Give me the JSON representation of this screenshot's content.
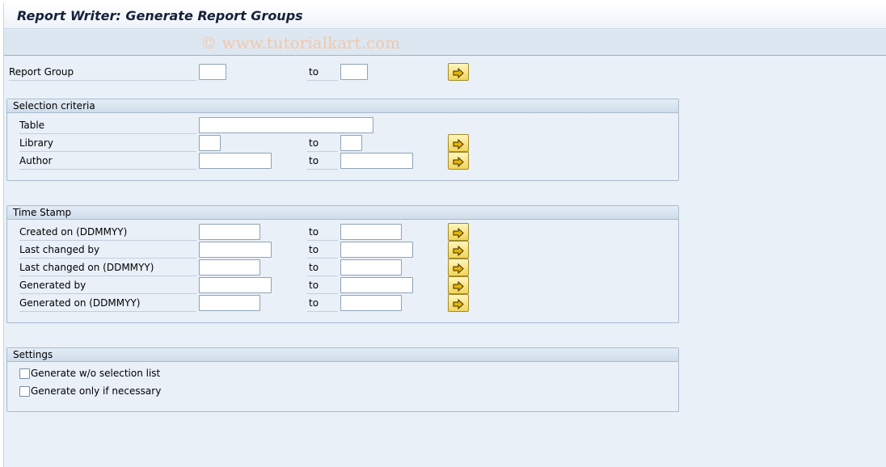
{
  "title": "Report Writer: Generate Report Groups",
  "watermark": "© www.tutorialkart.com",
  "report_group": {
    "label": "Report Group",
    "to": "to",
    "from_value": "",
    "to_value": ""
  },
  "selection_criteria": {
    "heading": "Selection criteria",
    "table": {
      "label": "Table",
      "value": ""
    },
    "library": {
      "label": "Library",
      "to": "to",
      "from_value": "",
      "to_value": ""
    },
    "author": {
      "label": "Author",
      "to": "to",
      "from_value": "",
      "to_value": ""
    }
  },
  "time_stamp": {
    "heading": "Time Stamp",
    "rows": [
      {
        "label": "Created on (DDMMYY)",
        "to": "to",
        "from_value": "",
        "to_value": ""
      },
      {
        "label": "Last changed by",
        "to": "to",
        "from_value": "",
        "to_value": ""
      },
      {
        "label": "Last changed on (DDMMYY)",
        "to": "to",
        "from_value": "",
        "to_value": ""
      },
      {
        "label": "Generated by",
        "to": "to",
        "from_value": "",
        "to_value": ""
      },
      {
        "label": "Generated on (DDMMYY)",
        "to": "to",
        "from_value": "",
        "to_value": ""
      }
    ]
  },
  "settings": {
    "heading": "Settings",
    "options": [
      {
        "label": "Generate w/o selection list",
        "checked": false
      },
      {
        "label": "Generate only if necessary",
        "checked": false
      }
    ]
  },
  "colors": {
    "background": "#e9f0f8",
    "button": "#f2d55a",
    "arrow": "#e8b400",
    "watermark": "#f3c7a7"
  },
  "icons": {
    "multiple_selection": "arrow-right-icon"
  }
}
